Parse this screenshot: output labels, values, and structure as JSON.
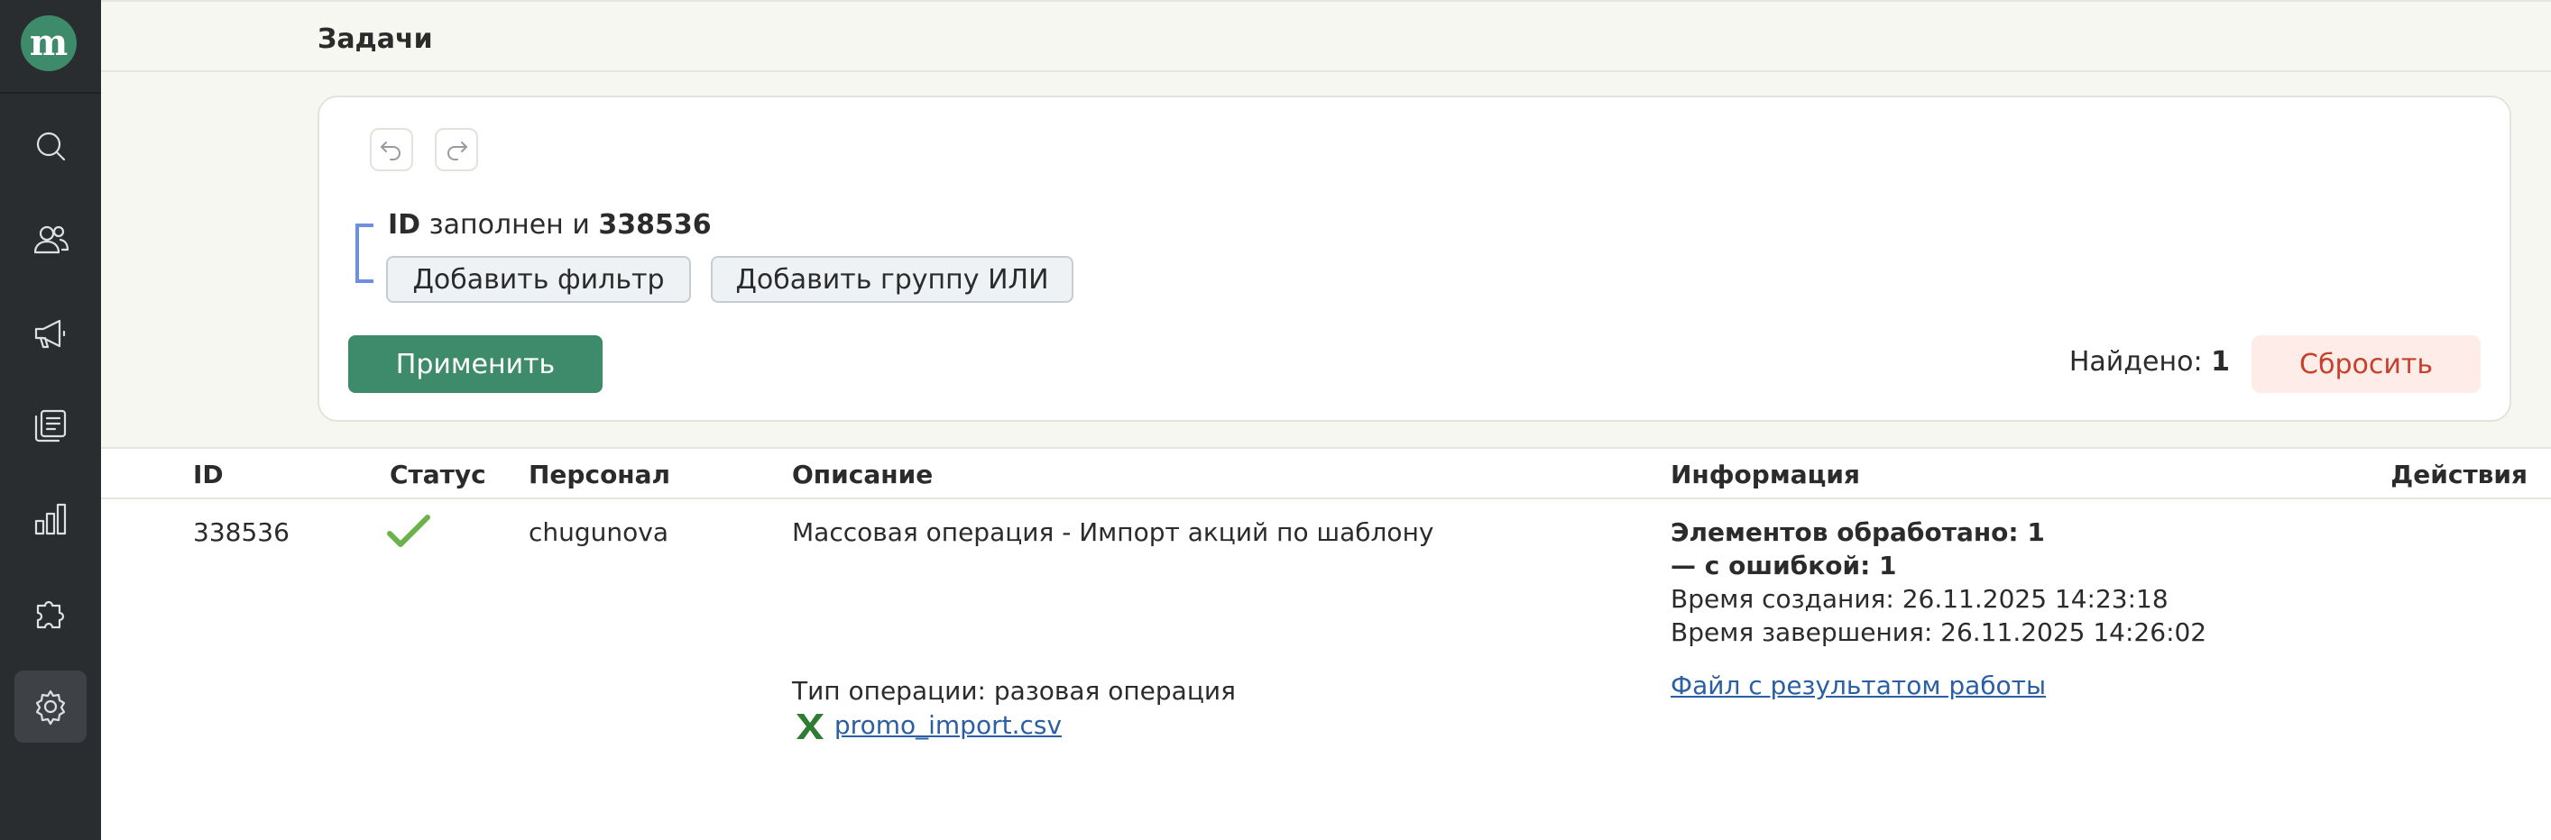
{
  "sidebar": {
    "logo_letter": "m",
    "items": [
      {
        "name": "search",
        "icon": "search-icon"
      },
      {
        "name": "users",
        "icon": "users-icon"
      },
      {
        "name": "campaigns",
        "icon": "megaphone-icon"
      },
      {
        "name": "content",
        "icon": "documents-icon"
      },
      {
        "name": "analytics",
        "icon": "bar-chart-icon"
      },
      {
        "name": "integrations",
        "icon": "puzzle-icon"
      },
      {
        "name": "settings",
        "icon": "gear-icon",
        "active": true
      }
    ]
  },
  "header": {
    "title": "Задачи"
  },
  "filter": {
    "undo_icon": "undo-icon",
    "redo_icon": "redo-icon",
    "condition": {
      "field": "ID",
      "operator": "заполнен и",
      "value": "338536"
    },
    "add_filter_label": "Добавить фильтр",
    "add_or_group_label": "Добавить группу ИЛИ",
    "apply_label": "Применить",
    "found_label": "Найдено:",
    "found_count": "1",
    "reset_label": "Сбросить"
  },
  "table": {
    "columns": [
      "ID",
      "Статус",
      "Персонал",
      "Описание",
      "Информация",
      "Действия"
    ],
    "rows": [
      {
        "id": "338536",
        "status_icon": "checkmark-icon",
        "staff": "chugunova",
        "description": "Массовая операция - Импорт акций по шаблону",
        "operation_type": "Тип операции: разовая операция",
        "file_name": "promo_import.csv",
        "info_processed": "Элементов обработано: 1",
        "info_errors": "— с ошибкой: 1",
        "info_created": "Время создания: 26.11.2025 14:23:18",
        "info_finished": "Время завершения: 26.11.2025 14:26:02",
        "result_file_link": "Файл с результатом работы"
      }
    ]
  },
  "colors": {
    "sidebar_bg": "#2a2d2f",
    "brand_green": "#3d8b6a",
    "reset_text": "#c8402b",
    "reset_bg": "#fdece8",
    "link": "#2b5fa3",
    "check": "#6cb24a",
    "bracket": "#6d8fe0"
  }
}
